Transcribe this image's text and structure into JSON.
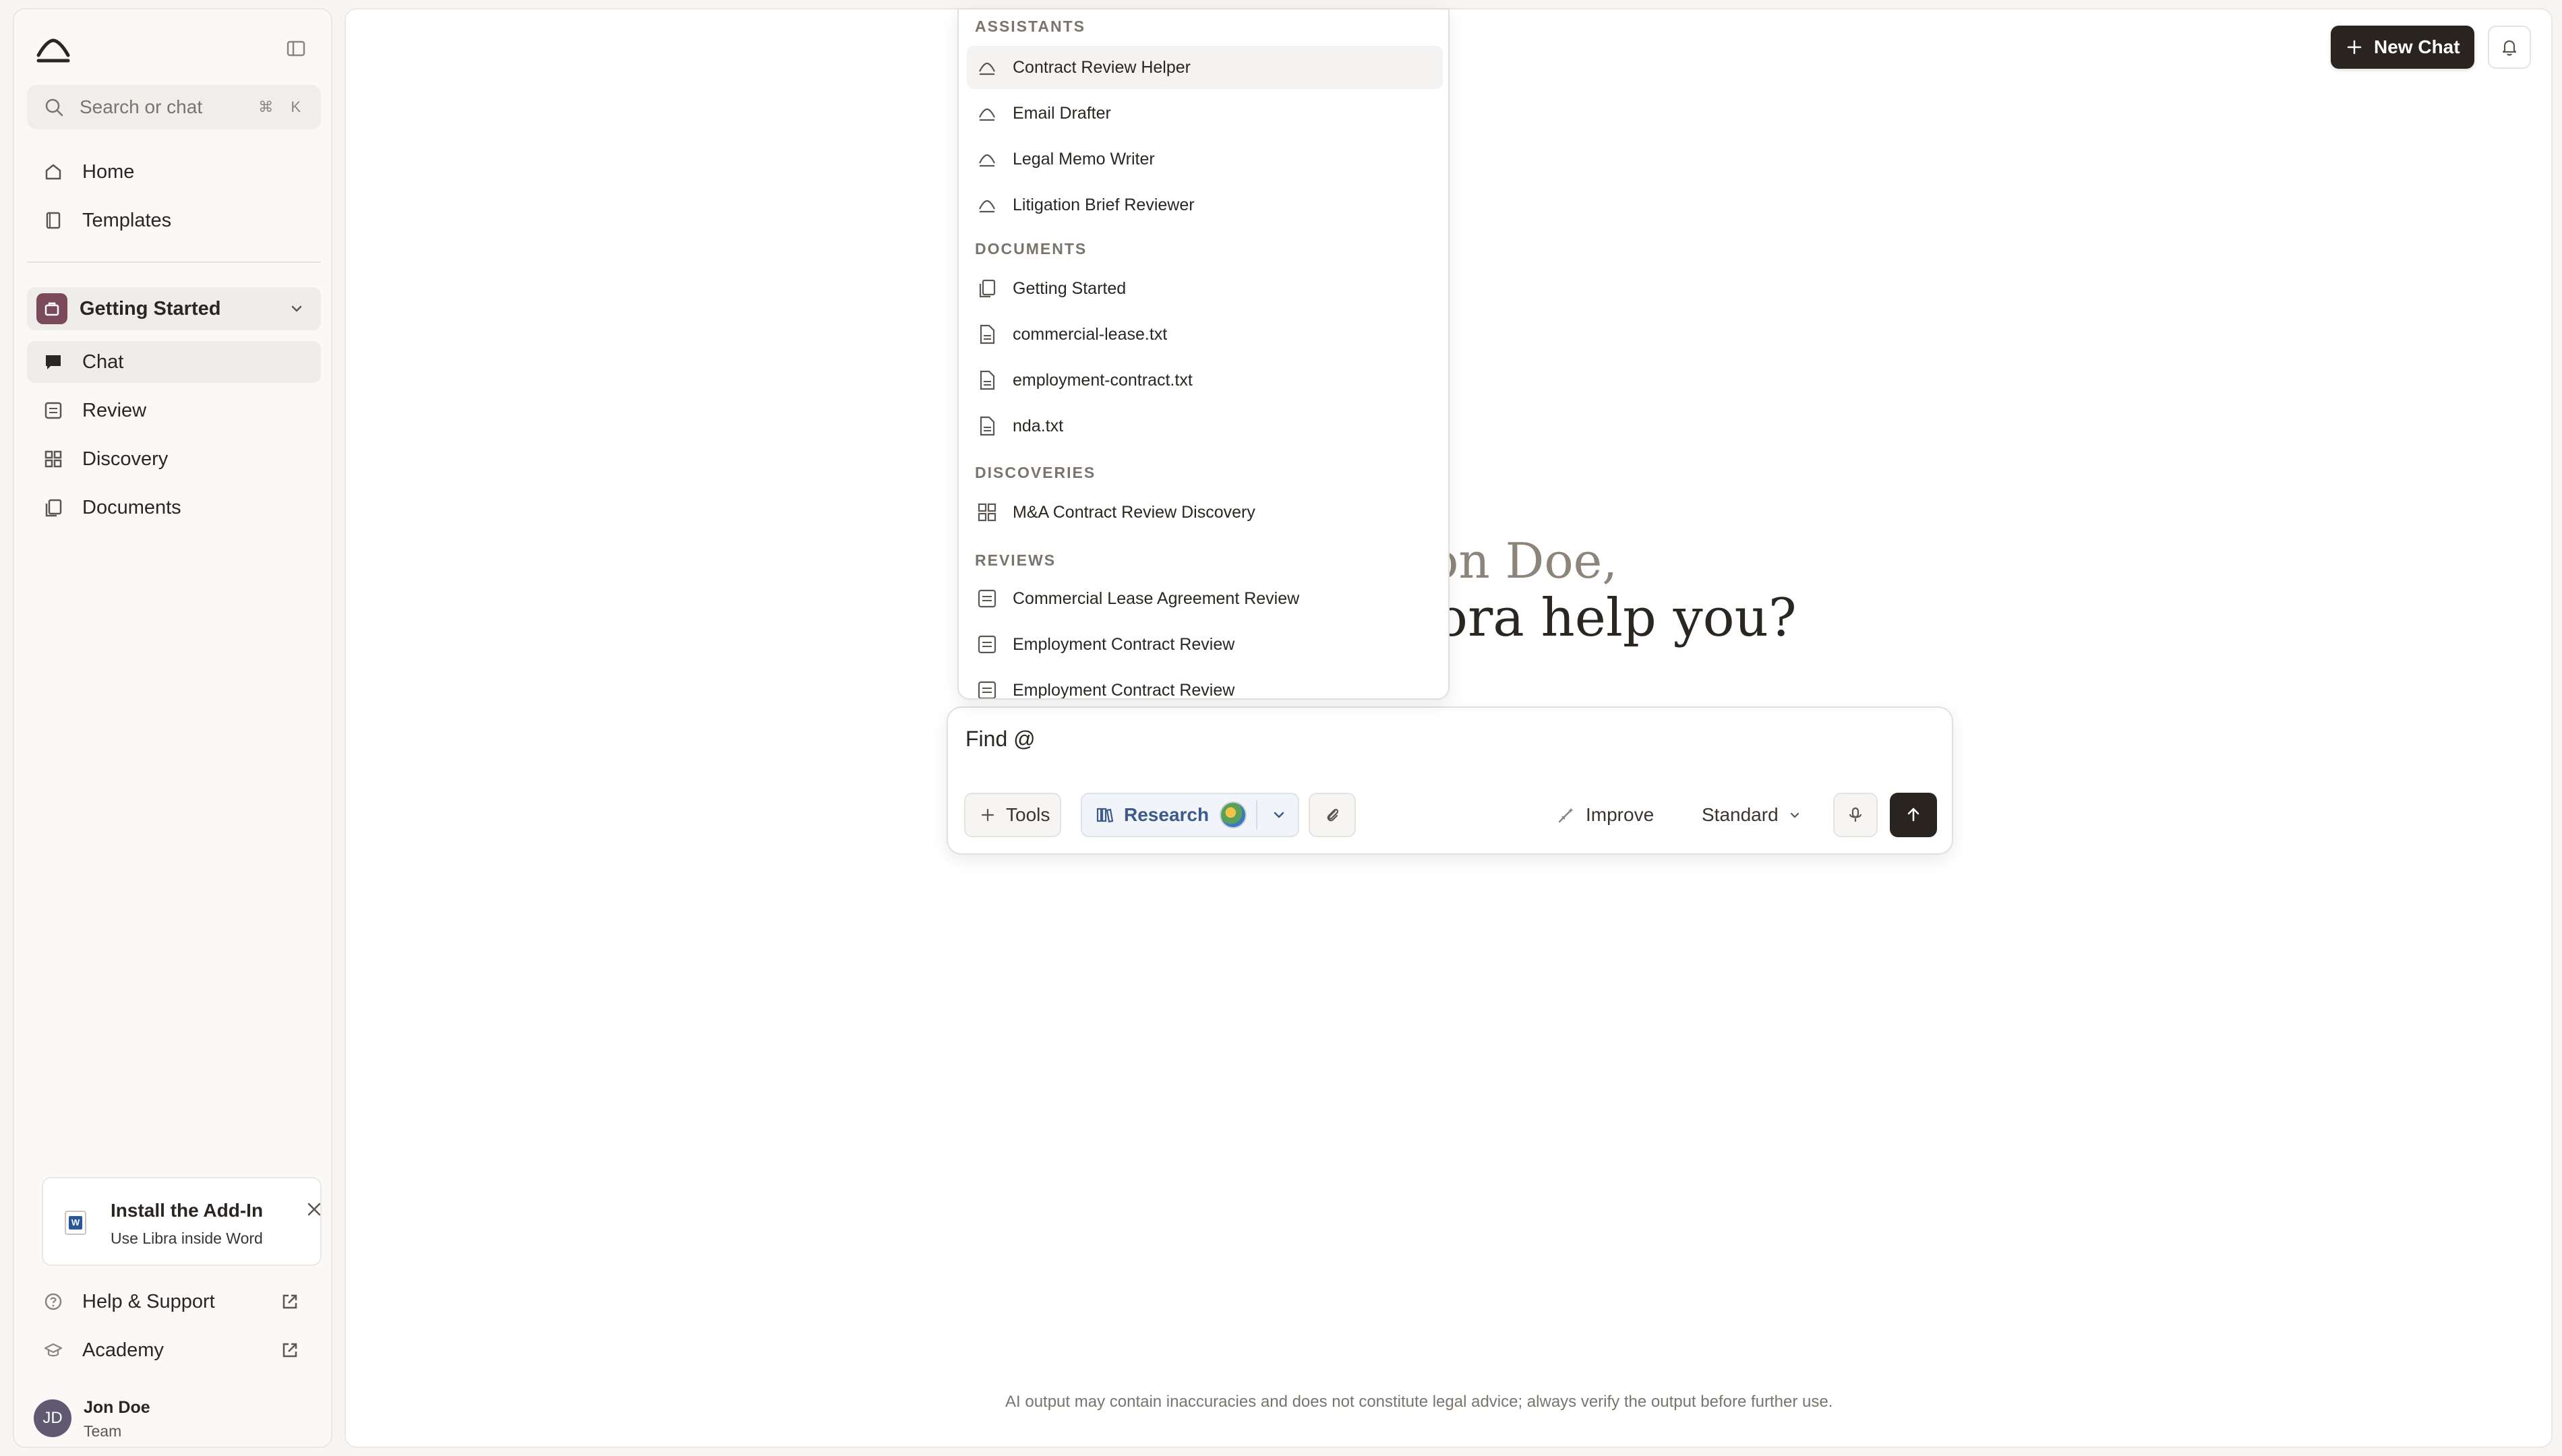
{
  "sidebar": {
    "search": {
      "placeholder": "Search or chat",
      "shortcut": "⌘ K"
    },
    "nav": [
      {
        "label": "Home",
        "icon": "home-icon"
      },
      {
        "label": "Templates",
        "icon": "book-icon"
      }
    ],
    "workspace": {
      "label": "Getting Started"
    },
    "workspace_nav": [
      {
        "label": "Chat",
        "icon": "chat-icon"
      },
      {
        "label": "Review",
        "icon": "review-icon"
      },
      {
        "label": "Discovery",
        "icon": "grid-icon"
      },
      {
        "label": "Documents",
        "icon": "documents-icon"
      }
    ],
    "addin": {
      "title": "Install the Add-In",
      "subtitle": "Use Libra inside Word"
    },
    "external": [
      {
        "label": "Help & Support",
        "icon": "help-icon"
      },
      {
        "label": "Academy",
        "icon": "graduation-cap-icon"
      }
    ],
    "user": {
      "initials": "JD",
      "name": "Jon Doe",
      "role": "Team"
    }
  },
  "header": {
    "new_chat_label": "New Chat"
  },
  "greeting": {
    "line1": "on Doe,",
    "line2": "ora help you?"
  },
  "composer": {
    "input_value": "Find @",
    "tools_label": "Tools",
    "research_label": "Research",
    "improve_label": "Improve",
    "mode_label": "Standard"
  },
  "dropdown": {
    "sections": [
      {
        "title": "ASSISTANTS",
        "items": [
          "Contract Review Helper",
          "Email Drafter",
          "Legal Memo Writer",
          "Litigation Brief Reviewer"
        ]
      },
      {
        "title": "DOCUMENTS",
        "items": [
          "Getting Started",
          "commercial-lease.txt",
          "employment-contract.txt",
          "nda.txt"
        ]
      },
      {
        "title": "DISCOVERIES",
        "items": [
          "M&A Contract Review Discovery"
        ]
      },
      {
        "title": "REVIEWS",
        "items": [
          "Commercial Lease Agreement Review",
          "Employment Contract Review",
          "Employment Contract Review"
        ]
      }
    ]
  },
  "footer": {
    "disclaimer": "AI output may contain inaccuracies and does not constitute legal advice; always verify the output before further use."
  }
}
